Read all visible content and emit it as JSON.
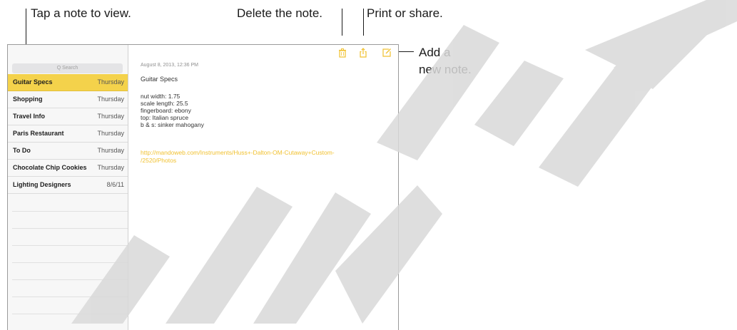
{
  "callouts": {
    "tap_note": "Tap a note to view.",
    "delete_note": "Delete the note.",
    "print_share": "Print or share.",
    "add_note_line1": "Add a",
    "add_note_line2": "new note."
  },
  "sidebar": {
    "search_placeholder": "Q  Search",
    "notes": [
      {
        "title": "Guitar Specs",
        "date": "Thursday",
        "selected": true
      },
      {
        "title": "Shopping",
        "date": "Thursday"
      },
      {
        "title": "Travel Info",
        "date": "Thursday"
      },
      {
        "title": "Paris Restaurant",
        "date": "Thursday"
      },
      {
        "title": "To Do",
        "date": "Thursday"
      },
      {
        "title": "Chocolate Chip Cookies",
        "date": "Thursday"
      },
      {
        "title": "Lighting Designers",
        "date": "8/6/11"
      }
    ]
  },
  "note": {
    "timestamp": "August 8, 2013, 12:36 PM",
    "title": "Guitar Specs",
    "lines": [
      "nut width:   1.75",
      "scale length:   25.5",
      "fingerboard:   ebony",
      "top:   Italian spruce",
      "b & s:   sinker mahogany"
    ],
    "link_lines": [
      "http://mandoweb.com/Instruments/Huss+-Dalton-OM-Cutaway+Custom-",
      "/2520/Photos"
    ]
  },
  "toolbar": {
    "icons": [
      "trash-icon",
      "share-icon",
      "compose-icon"
    ],
    "accent": "#f1c130"
  },
  "colors": {
    "selected_row": "#f4d24b",
    "accent_link": "#f1c130",
    "watermark": "#d9d9d9"
  }
}
